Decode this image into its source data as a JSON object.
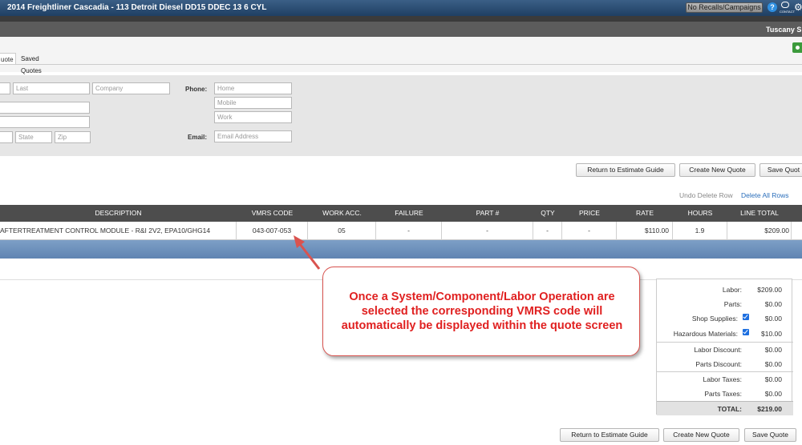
{
  "window": {
    "title": "2014 Freightliner Cascadia - 113 Detroit Diesel DD15 DDEC 13 6 CYL",
    "recalls_label": "No Recalls/Campaigns",
    "help_icon": "?",
    "contact_label": "CONTACT",
    "gear_icon": "⚙"
  },
  "header": {
    "shop_name": "Tuscany Sh"
  },
  "tabs": [
    {
      "label": "uote",
      "active": true
    },
    {
      "label": "Saved Quotes",
      "active": false
    }
  ],
  "customer": {
    "last_placeholder": "Last",
    "company_placeholder": "Company",
    "state_placeholder": "State",
    "zip_placeholder": "Zip",
    "phone_label": "Phone:",
    "home_placeholder": "Home",
    "mobile_placeholder": "Mobile",
    "work_placeholder": "Work",
    "email_label": "Email:",
    "email_placeholder": "Email Address"
  },
  "actions_top": {
    "return": "Return to Estimate Guide",
    "create": "Create New Quote",
    "save": "Save Quot"
  },
  "table_links": {
    "undo": "Undo Delete Row",
    "delete_all": "Delete All Rows"
  },
  "table": {
    "headers": [
      "DESCRIPTION",
      "VMRS CODE",
      "WORK ACC.",
      "FAILURE",
      "PART #",
      "QTY",
      "PRICE",
      "RATE",
      "HOURS",
      "LINE TOTAL"
    ],
    "row": [
      "AFTERTREATMENT CONTROL MODULE - R&I 2V2, EPA10/GHG14",
      "043-007-053",
      "05",
      "-",
      "-",
      "-",
      "-",
      "$110.00",
      "1.9",
      "$209.00"
    ]
  },
  "totals": {
    "labor_label": "Labor:",
    "labor": "$209.00",
    "parts_label": "Parts:",
    "parts": "$0.00",
    "shop_supplies_label": "Shop Supplies:",
    "shop_supplies": "$0.00",
    "hazardous_label": "Hazardous Materials:",
    "hazardous": "$10.00",
    "labor_discount_label": "Labor Discount:",
    "labor_discount": "$0.00",
    "parts_discount_label": "Parts Discount:",
    "parts_discount": "$0.00",
    "labor_taxes_label": "Labor Taxes:",
    "labor_taxes": "$0.00",
    "parts_taxes_label": "Parts Taxes:",
    "parts_taxes": "$0.00",
    "total_label": "TOTAL:",
    "total": "$219.00"
  },
  "actions_bottom": {
    "return": "Return to Estimate Guide",
    "create": "Create New Quote",
    "save": "Save Quote"
  },
  "callout": {
    "text": "Once a System/Component/Labor Operation are selected the corresponding VMRS code will automatically be displayed within the quote screen"
  }
}
